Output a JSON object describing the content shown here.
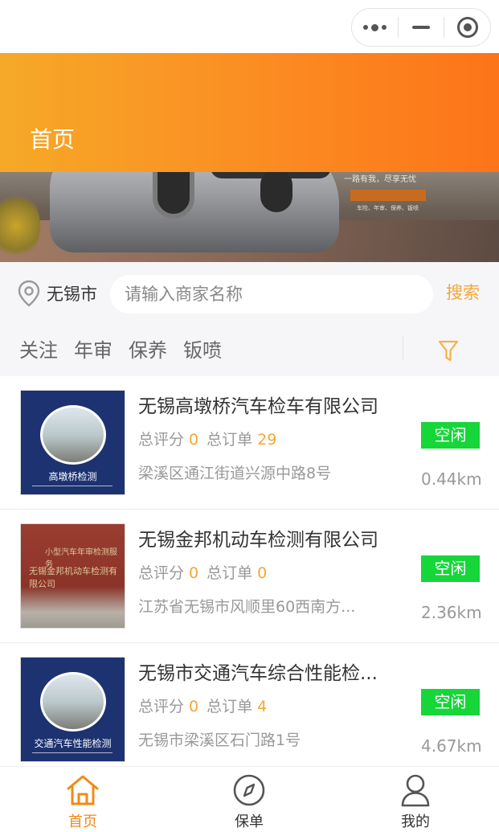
{
  "capsule": {
    "more_icon": "more-dots-icon",
    "minimize_icon": "minus-icon",
    "close_icon": "target-icon"
  },
  "header": {
    "title": "首页"
  },
  "banner": {
    "slogan": "一路有我，尽享无忧",
    "subtext": "车险、年审、保养、钣喷"
  },
  "search": {
    "location": "无锡市",
    "placeholder": "请输入商家名称",
    "button": "搜索"
  },
  "tabs": [
    "关注",
    "年审",
    "保养",
    "钣喷"
  ],
  "list": [
    {
      "name": "无锡高墩桥汽车检车有限公司",
      "rating_label": "总评分",
      "rating": "0",
      "orders_label": "总订单",
      "orders": "29",
      "address": "梁溪区通江街道兴源中路8号",
      "status": "空闲",
      "distance": "0.44km",
      "thumb_caption": "高墩桥检测"
    },
    {
      "name": "无锡金邦机动车检测有限公司",
      "rating_label": "总评分",
      "rating": "0",
      "orders_label": "总订单",
      "orders": "0",
      "address": "江苏省无锡市风顺里60西南方...",
      "status": "空闲",
      "distance": "2.36km",
      "thumb_text1": "小型汽车年审检测服务",
      "thumb_text2": "无锡金邦机动车检测有限公司"
    },
    {
      "name": "无锡市交通汽车综合性能检...",
      "rating_label": "总评分",
      "rating": "0",
      "orders_label": "总订单",
      "orders": "4",
      "address": "无锡市梁溪区石门路1号",
      "status": "空闲",
      "distance": "4.67km",
      "thumb_caption": "交通汽车性能检测"
    }
  ],
  "tabbar": [
    {
      "label": "首页",
      "icon": "home-icon",
      "active": true
    },
    {
      "label": "保单",
      "icon": "compass-icon",
      "active": false
    },
    {
      "label": "我的",
      "icon": "user-icon",
      "active": false
    }
  ],
  "colors": {
    "accent": "#f4a637",
    "header_start": "#f6a928",
    "header_end": "#fd7419",
    "status_green": "#16d63a"
  }
}
